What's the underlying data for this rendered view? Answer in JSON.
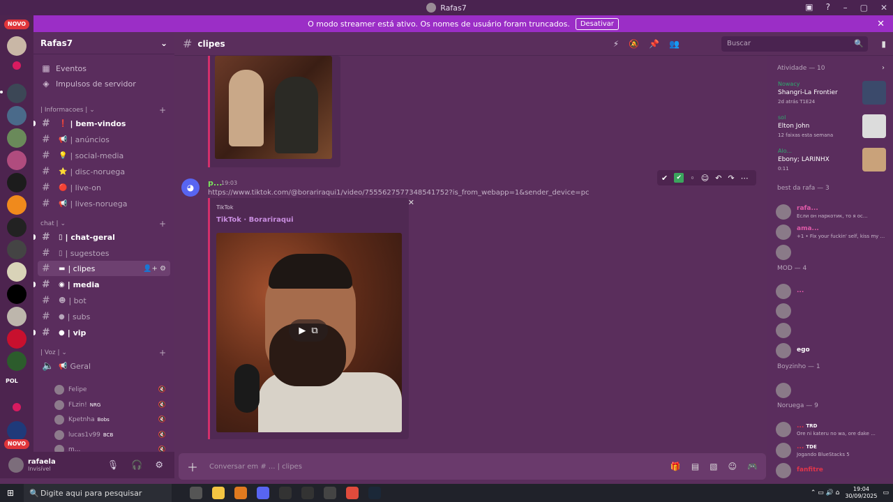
{
  "window": {
    "title": "Rafas7"
  },
  "notice": {
    "text": "O modo streamer está ativo. Os nomes de usuário foram truncados.",
    "button": "Desativar"
  },
  "guilds": {
    "badge_top": "NOVO",
    "badge_bottom": "NOVO",
    "pol_label": "POL"
  },
  "server": {
    "name": "Rafas7",
    "events": "Eventos",
    "boosts": "Impulsos de servidor"
  },
  "categories": {
    "info": "| Informacoes |",
    "chat": "chat |",
    "voice": "| Voz |"
  },
  "channels": [
    {
      "emoji": "❗",
      "label": "bem-vindos",
      "unread": true
    },
    {
      "emoji": "📢",
      "label": "anúncios",
      "unread": false
    },
    {
      "emoji": "💡",
      "label": "social-media",
      "unread": false
    },
    {
      "emoji": "⭐",
      "label": "disc-noruega",
      "unread": false
    },
    {
      "emoji": "🔴",
      "label": "live-on",
      "unread": false
    },
    {
      "emoji": "📢",
      "label": "lives-noruega",
      "unread": false
    },
    {
      "emoji": "▯",
      "label": "chat-geral",
      "unread": true
    },
    {
      "emoji": "▯",
      "label": "sugestoes",
      "unread": false
    },
    {
      "emoji": "▬",
      "label": "clipes",
      "active": true
    },
    {
      "emoji": "◉",
      "label": "media",
      "unread": true
    },
    {
      "emoji": "☻",
      "label": "bot",
      "unread": false
    },
    {
      "emoji": "●",
      "label": "subs",
      "unread": false
    },
    {
      "emoji": "●",
      "label": "vip",
      "unread": true
    }
  ],
  "voice": {
    "channel": "Geral",
    "users": [
      {
        "name": "Felipe",
        "tag": ""
      },
      {
        "name": "FLzin!",
        "tag": "NRG"
      },
      {
        "name": "Kpetnha",
        "tag": "Bobs"
      },
      {
        "name": "lucas1v99",
        "tag": "BCB"
      },
      {
        "name": "m...",
        "tag": ""
      }
    ]
  },
  "user": {
    "name": "rafaela",
    "status": "Invisível"
  },
  "channel": {
    "name": "clipes",
    "search_placeholder": "Buscar"
  },
  "message": {
    "author": "p...",
    "time": "19:03",
    "link": "https://www.tiktok.com/@borariraqui1/video/7555627577348541752?is_from_webapp=1&sender_device=pc",
    "embed_provider": "TikTok",
    "embed_title": "TikTok · Borariraqui"
  },
  "composer": {
    "placeholder": "Conversar em # ... | clipes"
  },
  "activity": {
    "title": "Atividade — 10",
    "items": [
      {
        "user": "Nowacy",
        "title": "Shangri-La Frontier",
        "sub": "2d atrás  T1E24"
      },
      {
        "user": "sol",
        "title": "Elton John",
        "sub": "12 faixas esta semana"
      },
      {
        "user": "Alo...",
        "title": "Ebony; LARINHX",
        "sub": "0:11"
      }
    ]
  },
  "groups": [
    {
      "title": "best da rafa — 3",
      "members": [
        {
          "name": "rafa...",
          "status": "Если он наркотик, то я ос...",
          "color": "#e05aa8"
        },
        {
          "name": "ama...",
          "status": "+1 • Fix your fuckin' self, kiss my ...",
          "color": "#e05aa8"
        },
        {
          "name": "",
          "status": "",
          "color": "#e05aa8"
        }
      ]
    },
    {
      "title": "MOD — 4",
      "members": [
        {
          "name": "...",
          "status": "",
          "color": "#e05aa8"
        },
        {
          "name": "",
          "status": "",
          "color": "#e05aa8"
        },
        {
          "name": "",
          "status": "",
          "color": "#e05aa8"
        },
        {
          "name": "ego",
          "status": "",
          "color": "#ffffff"
        }
      ]
    },
    {
      "title": "Boyzinho — 1",
      "members": [
        {
          "name": "",
          "status": "",
          "color": "#e05aa8"
        }
      ]
    },
    {
      "title": "Noruega — 9",
      "members": [
        {
          "name": "...",
          "status": "Ore ni kateru no wa, ore dake ...",
          "color": "#e0354a",
          "tag": "TRD"
        },
        {
          "name": "...",
          "status": "Jogando BlueStacks 5",
          "color": "#e0354a",
          "tag": "TDE"
        },
        {
          "name": "fanfitre",
          "status": "",
          "color": "#e0354a"
        },
        {
          "name": "...",
          "status": "",
          "color": "#e0354a",
          "tag": "MIBR"
        }
      ]
    }
  ],
  "taskbar": {
    "search": "Digite aqui para pesquisar",
    "time": "19:04",
    "date": "30/09/2025"
  }
}
